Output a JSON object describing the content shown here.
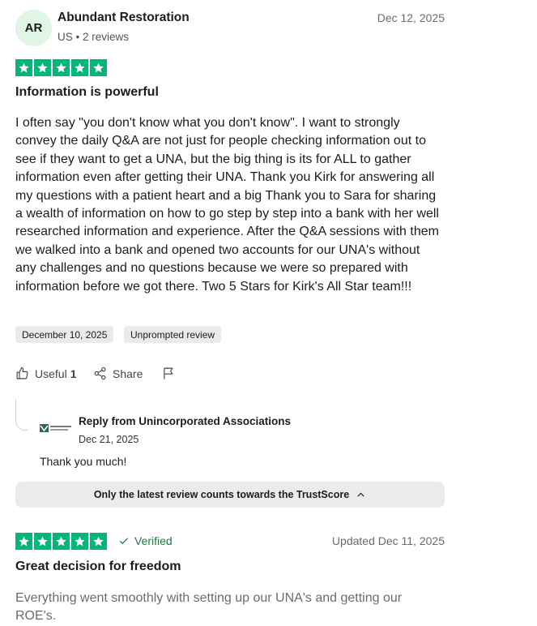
{
  "review1": {
    "avatar_initials": "AR",
    "reviewer_name": "Abundant Restoration",
    "reviewer_meta": "US • 2 reviews",
    "date": "Dec 12, 2025",
    "rating": 5,
    "title": "Information is powerful",
    "body": "I often say \"you don't know what you don't know\". I want to strongly convey the daily Q&A are not just for people checking information out to see if they want to get a UNA, but the big thing is its for ALL to gather information even after getting their UNA. Thank you Kirk for answering all my questions with a patient heart and a big Thank you to Sara for sharing a wealth of information on how to go step by step into a bank with her well researched information and experience. After the Q&A sessions with them we walked into a bank and opened two accounts for our UNA's without any challenges and no questions because we were so prepared with information before we got there. Two 5 Stars for Kirk's All Star team!!!",
    "experience_date": "December 10, 2025",
    "tag": "Unprompted review",
    "useful_label": "Useful",
    "useful_count": "1",
    "share_label": "Share",
    "reply": {
      "from": "Reply from Unincorporated Associations",
      "date": "Dec 21, 2025",
      "text": "Thank you much!",
      "logo_icon": "una-logo"
    }
  },
  "trustscore_note": "Only the latest review counts towards the TrustScore",
  "review2": {
    "rating": 5,
    "verified_label": "Verified",
    "updated": "Updated Dec 11, 2025",
    "title": "Great decision for freedom",
    "body": "Everything went smoothly with setting up our UNA's and getting our ROE's."
  },
  "colors": {
    "star_green": "#00b67a",
    "avatar_bg": "#e0f5e4",
    "verified_green": "#1b7a43",
    "chip_bg": "#eaeaea"
  }
}
